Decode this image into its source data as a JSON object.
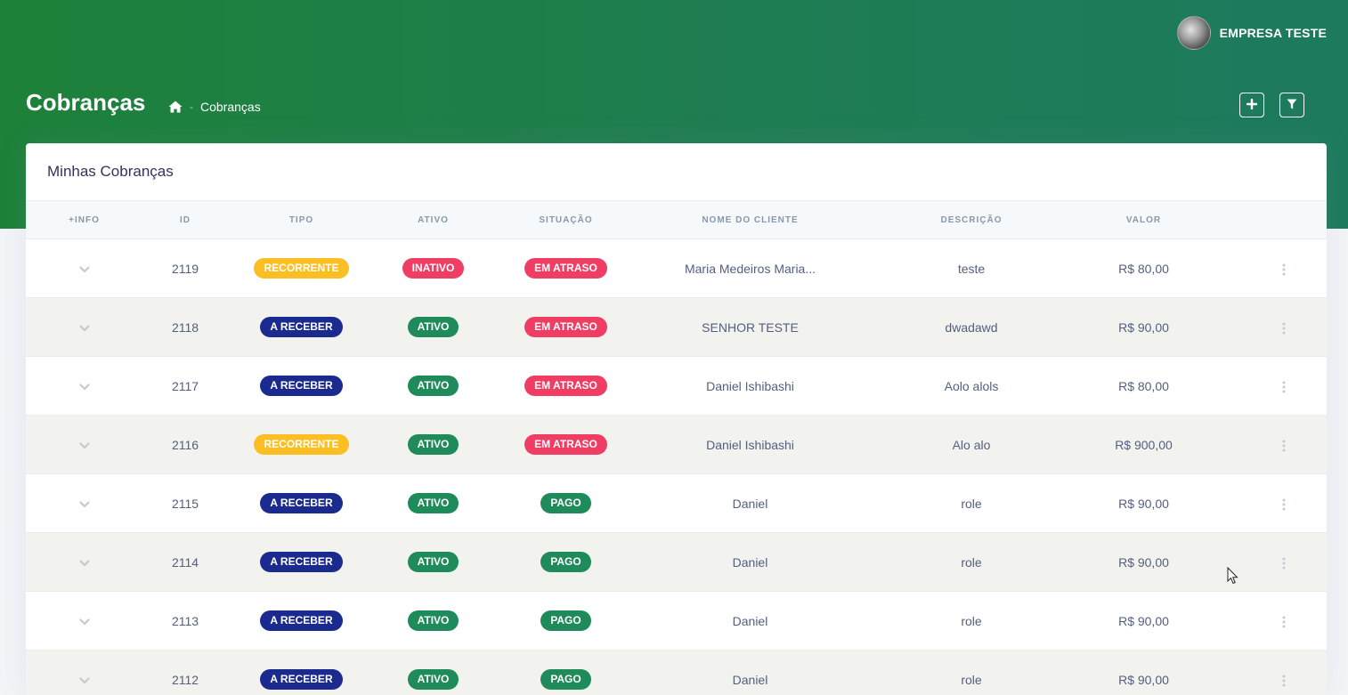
{
  "header": {
    "user_name": "EMPRESA TESTE",
    "page_title": "Cobranças",
    "breadcrumb_current": "Cobranças",
    "breadcrumb_separator": "-"
  },
  "card": {
    "title": "Minhas Cobranças"
  },
  "table": {
    "columns": [
      "+INFO",
      "ID",
      "TIPO",
      "ATIVO",
      "SITUAÇÃO",
      "NOME DO CLIENTE",
      "DESCRIÇÃO",
      "VALOR",
      ""
    ],
    "rows": [
      {
        "id": "2119",
        "tipo": "RECORRENTE",
        "ativo": "INATIVO",
        "situacao": "EM ATRASO",
        "cliente": "Maria Medeiros Maria...",
        "descricao": "teste",
        "valor": "R$ 80,00"
      },
      {
        "id": "2118",
        "tipo": "A RECEBER",
        "ativo": "ATIVO",
        "situacao": "EM ATRASO",
        "cliente": "SENHOR TESTE",
        "descricao": "dwadawd",
        "valor": "R$ 90,00"
      },
      {
        "id": "2117",
        "tipo": "A RECEBER",
        "ativo": "ATIVO",
        "situacao": "EM ATRASO",
        "cliente": "Daniel Ishibashi",
        "descricao": "Aolo alols",
        "valor": "R$ 80,00"
      },
      {
        "id": "2116",
        "tipo": "RECORRENTE",
        "ativo": "ATIVO",
        "situacao": "EM ATRASO",
        "cliente": "Daniel Ishibashi",
        "descricao": "Alo alo",
        "valor": "R$ 900,00"
      },
      {
        "id": "2115",
        "tipo": "A RECEBER",
        "ativo": "ATIVO",
        "situacao": "PAGO",
        "cliente": "Daniel",
        "descricao": "role",
        "valor": "R$ 90,00"
      },
      {
        "id": "2114",
        "tipo": "A RECEBER",
        "ativo": "ATIVO",
        "situacao": "PAGO",
        "cliente": "Daniel",
        "descricao": "role",
        "valor": "R$ 90,00"
      },
      {
        "id": "2113",
        "tipo": "A RECEBER",
        "ativo": "ATIVO",
        "situacao": "PAGO",
        "cliente": "Daniel",
        "descricao": "role",
        "valor": "R$ 90,00"
      },
      {
        "id": "2112",
        "tipo": "A RECEBER",
        "ativo": "ATIVO",
        "situacao": "PAGO",
        "cliente": "Daniel",
        "descricao": "role",
        "valor": "R$ 90,00"
      }
    ]
  },
  "colors": {
    "RECORRENTE": "#fbbf24",
    "A RECEBER": "#1b2a8f",
    "INATIVO": "#f03d63",
    "ATIVO": "#1f8a5a",
    "EM ATRASO": "#f03d63",
    "PAGO": "#1f8a5a"
  },
  "icons": {
    "home": "home-icon",
    "add": "plus-icon",
    "filter": "filter-icon",
    "expand": "chevron-down-icon",
    "row_menu": "kebab-menu-icon"
  }
}
